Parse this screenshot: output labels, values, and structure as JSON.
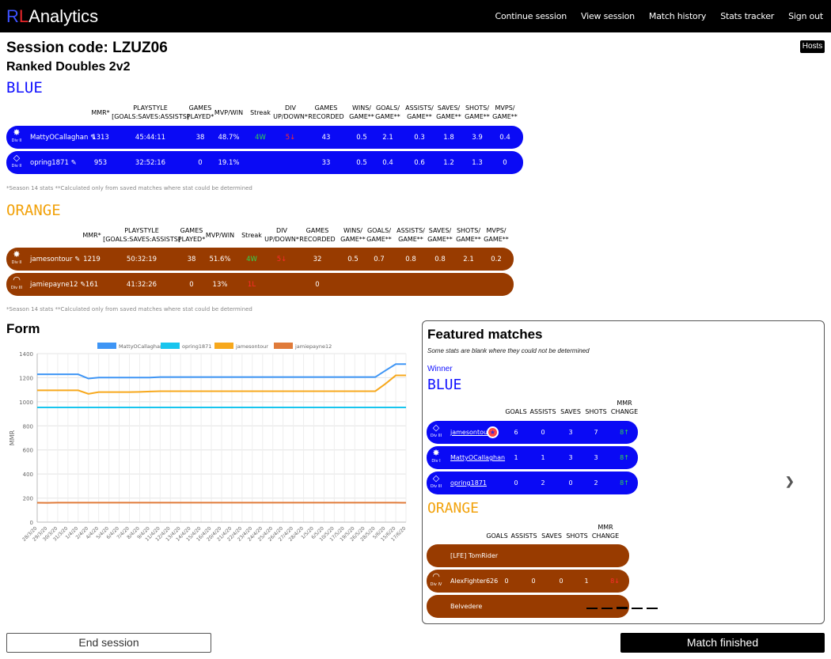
{
  "brand": {
    "r": "R",
    "l": "L",
    "rest": "Analytics"
  },
  "nav": [
    "Continue session",
    "View session",
    "Match history",
    "Stats tracker",
    "Sign out"
  ],
  "hosts_label": "Hosts",
  "session_code": "Session code: LZUZ06",
  "mode": "Ranked Doubles 2v2",
  "blue_label": "BLUE",
  "orange_label": "ORANGE",
  "stats_headers": [
    [
      "MMR*"
    ],
    [
      "PLAYSTYLE",
      "[GOALS:SAVES:ASSISTS]"
    ],
    [
      "GAMES",
      "PLAYED*"
    ],
    [
      "MVP/WIN"
    ],
    [
      "Streak"
    ],
    [
      "DIV",
      "UP/DOWN*"
    ],
    [
      "GAMES",
      "RECORDED"
    ],
    [
      "WINS/",
      "GAME**"
    ],
    [
      "GOALS/",
      "GAME**"
    ],
    [
      "ASSISTS/",
      "GAME**"
    ],
    [
      "SAVES/",
      "GAME**"
    ],
    [
      "SHOTS/",
      "GAME**"
    ],
    [
      "MVPS/",
      "GAME**"
    ]
  ],
  "blue_players": [
    {
      "rank_icon": "gear-rank-icon",
      "div": "Div II",
      "name": "MattyOCallaghan",
      "mmr": "1313",
      "playstyle": "45:44:11",
      "games_played": "38",
      "mvp_win": "48.7%",
      "streak": "4W",
      "div_change": "5↓",
      "recorded": "43",
      "wins": "0.5",
      "goals": "2.1",
      "assists": "0.3",
      "saves": "1.8",
      "shots": "3.9",
      "mvps": "0.4"
    },
    {
      "rank_icon": "diamond-rank-icon",
      "div": "Div II",
      "name": "opring1871",
      "mmr": "953",
      "playstyle": "32:52:16",
      "games_played": "0",
      "mvp_win": "19.1%",
      "streak": "",
      "div_change": "",
      "recorded": "33",
      "wins": "0.5",
      "goals": "0.4",
      "assists": "0.6",
      "saves": "1.2",
      "shots": "1.3",
      "mvps": "0"
    }
  ],
  "orange_players": [
    {
      "rank_icon": "gear-rank-icon",
      "div": "Div II",
      "name": "jamesontour",
      "mmr": "1219",
      "playstyle": "50:32:19",
      "games_played": "38",
      "mvp_win": "51.6%",
      "streak": "4W",
      "div_change": "5↓",
      "recorded": "32",
      "wins": "0.5",
      "goals": "0.7",
      "assists": "0.8",
      "saves": "0.8",
      "shots": "2.1",
      "mvps": "0.2"
    },
    {
      "rank_icon": "champion-rank-icon",
      "div": "Div III",
      "name": "jamiepayne12",
      "mmr": "161",
      "playstyle": "41:32:26",
      "games_played": "0",
      "mvp_win": "13%",
      "streak": "1L",
      "div_change": "",
      "recorded": "0",
      "wins": "",
      "goals": "",
      "assists": "",
      "saves": "",
      "shots": "",
      "mvps": ""
    }
  ],
  "footnote": "*Season 14 stats  **Calculated only from saved matches where stat could be determined",
  "form_title": "Form",
  "chart_data": {
    "type": "line",
    "ylabel": "MMR",
    "ylim": [
      0,
      1400
    ],
    "yticks": [
      0,
      200,
      400,
      600,
      800,
      1000,
      1200,
      1400
    ],
    "grid": true,
    "legend_position": "top",
    "x": [
      "28/3/20",
      "29/3/20",
      "30/3/20",
      "31/3/20",
      "1/4/20",
      "2/4/20",
      "4/4/20",
      "5/4/20",
      "6/4/20",
      "7/4/20",
      "8/4/20",
      "9/4/20",
      "11/4/20",
      "12/4/20",
      "13/4/20",
      "14/4/20",
      "15/4/20",
      "16/4/20",
      "20/4/20",
      "21/4/20",
      "22/4/20",
      "23/4/20",
      "24/4/20",
      "25/4/20",
      "26/4/20",
      "27/4/20",
      "28/4/20",
      "1/5/20",
      "6/5/20",
      "10/5/20",
      "17/5/20",
      "19/5/20",
      "26/5/20",
      "28/5/20",
      "5/6/20",
      "15/6/20",
      "17/6/20"
    ],
    "series": [
      {
        "name": "MattyOCallaghan",
        "color": "#3e95f5",
        "values": [
          1228,
          1228,
          1228,
          1228,
          1228,
          1193,
          1201,
          1201,
          1201,
          1201,
          1201,
          1201,
          1205,
          1205,
          1205,
          1205,
          1205,
          1205,
          1205,
          1205,
          1205,
          1205,
          1205,
          1205,
          1205,
          1205,
          1205,
          1205,
          1205,
          1205,
          1205,
          1205,
          1205,
          1205,
          1260,
          1313,
          1313
        ]
      },
      {
        "name": "opring1871",
        "color": "#18c5ee",
        "values": [
          953,
          953,
          953,
          953,
          953,
          953,
          953,
          953,
          953,
          953,
          953,
          953,
          953,
          953,
          953,
          953,
          953,
          953,
          953,
          953,
          953,
          953,
          953,
          953,
          953,
          953,
          953,
          953,
          953,
          953,
          953,
          953,
          953,
          953,
          953,
          953,
          953
        ]
      },
      {
        "name": "jamesontour",
        "color": "#f7a81c",
        "values": [
          1095,
          1095,
          1095,
          1095,
          1095,
          1066,
          1080,
          1080,
          1080,
          1080,
          1082,
          1085,
          1088,
          1088,
          1088,
          1088,
          1088,
          1088,
          1088,
          1088,
          1088,
          1088,
          1088,
          1088,
          1088,
          1088,
          1088,
          1088,
          1088,
          1088,
          1088,
          1088,
          1088,
          1088,
          1150,
          1219,
          1219
        ]
      },
      {
        "name": "jamiepayne12",
        "color": "#e07b3a",
        "values": [
          161,
          160,
          162,
          162,
          162,
          162,
          162,
          162,
          162,
          162,
          162,
          162,
          162,
          162,
          162,
          162,
          162,
          162,
          162,
          162,
          162,
          162,
          162,
          162,
          162,
          162,
          162,
          162,
          162,
          162,
          162,
          162,
          162,
          162,
          162,
          162,
          161
        ]
      }
    ]
  },
  "featured": {
    "title": "Featured matches",
    "subtitle": "Some stats are blank where they could not be determined",
    "winner_label": "Winner",
    "blue_label": "BLUE",
    "orange_label": "ORANGE",
    "headers": [
      [
        "GOALS"
      ],
      [
        "ASSISTS"
      ],
      [
        "SAVES"
      ],
      [
        "SHOTS"
      ],
      [
        "MMR",
        "CHANGE"
      ]
    ],
    "blue": [
      {
        "rank_icon": "diamond-rank-icon",
        "div": "Div III",
        "name": "jamesontour",
        "mvp_badge": "★",
        "goals": "6",
        "assists": "0",
        "saves": "3",
        "shots": "7",
        "mmr": "8↑"
      },
      {
        "rank_icon": "gear-rank-icon",
        "div": "Div I",
        "name": "MattyOCallaghan",
        "goals": "1",
        "assists": "1",
        "saves": "3",
        "shots": "3",
        "mmr": "8↑"
      },
      {
        "rank_icon": "diamond-rank-icon",
        "div": "Div III",
        "name": "opring1871",
        "goals": "0",
        "assists": "2",
        "saves": "0",
        "shots": "2",
        "mmr": "8↑"
      }
    ],
    "orange": [
      {
        "rank_icon": "",
        "div": "",
        "name": "[LFE] TomRider",
        "goals": "",
        "assists": "",
        "saves": "",
        "shots": "",
        "mmr": ""
      },
      {
        "rank_icon": "champion-rank-icon",
        "div": "Div IV",
        "name": "AlexFighter626",
        "goals": "0",
        "assists": "0",
        "saves": "0",
        "shots": "1",
        "mmr": "8↓"
      },
      {
        "rank_icon": "",
        "div": "",
        "name": "Belvedere",
        "goals": "",
        "assists": "",
        "saves": "",
        "shots": "",
        "mmr": ""
      }
    ],
    "next_icon": "chevron-right-icon",
    "slides": 5,
    "active_slide": 3
  },
  "end_session_label": "End session",
  "match_finished_label": "Match finished"
}
